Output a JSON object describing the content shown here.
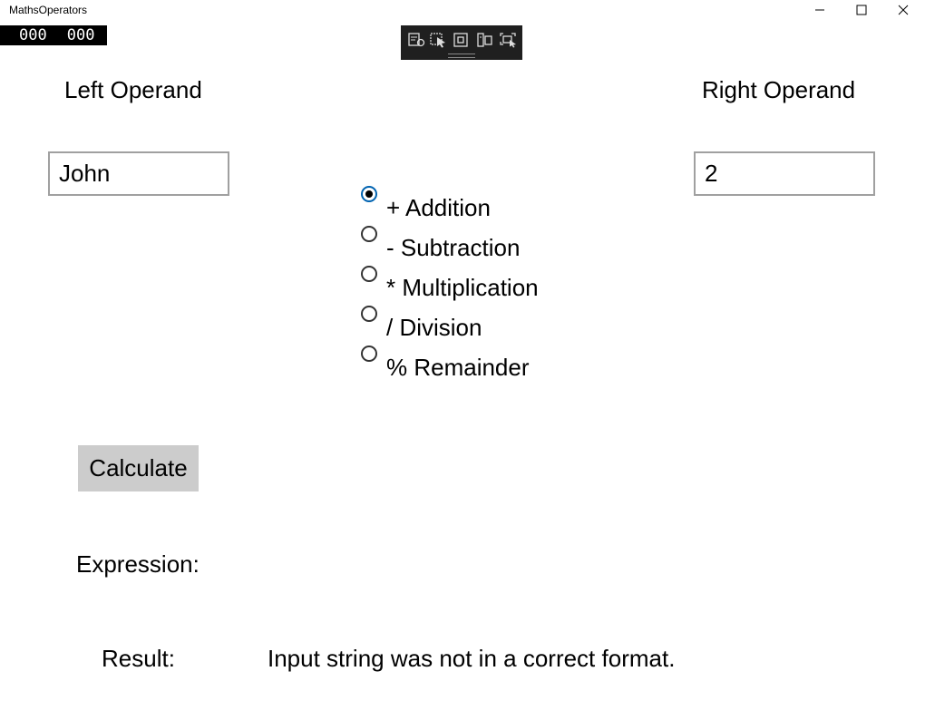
{
  "window": {
    "title": "MathsOperators"
  },
  "frame_counter": {
    "left": "000",
    "right": "000"
  },
  "debug_toolbar": {
    "icons": [
      "live-visual-tree-icon",
      "select-element-icon",
      "display-layout-adorners-icon",
      "track-focus-icon",
      "hot-reload-icon"
    ]
  },
  "left_operand": {
    "label": "Left Operand",
    "value": "John"
  },
  "right_operand": {
    "label": "Right Operand",
    "value": "2"
  },
  "operators": [
    {
      "label": "+ Addition",
      "selected": true
    },
    {
      "label": "- Subtraction",
      "selected": false
    },
    {
      "label": "* Multiplication",
      "selected": false
    },
    {
      "label": "/ Division",
      "selected": false
    },
    {
      "label": "% Remainder",
      "selected": false
    }
  ],
  "calculate_button": {
    "label": "Calculate"
  },
  "expression": {
    "label": "Expression:",
    "value": ""
  },
  "result": {
    "label": "Result:",
    "value": "Input string was not in a correct format."
  },
  "colors": {
    "accent": "#0063b1",
    "button_bg": "#cccccc",
    "textbox_border": "#a0a0a0",
    "toolbar_bg": "#1f1f1f"
  }
}
